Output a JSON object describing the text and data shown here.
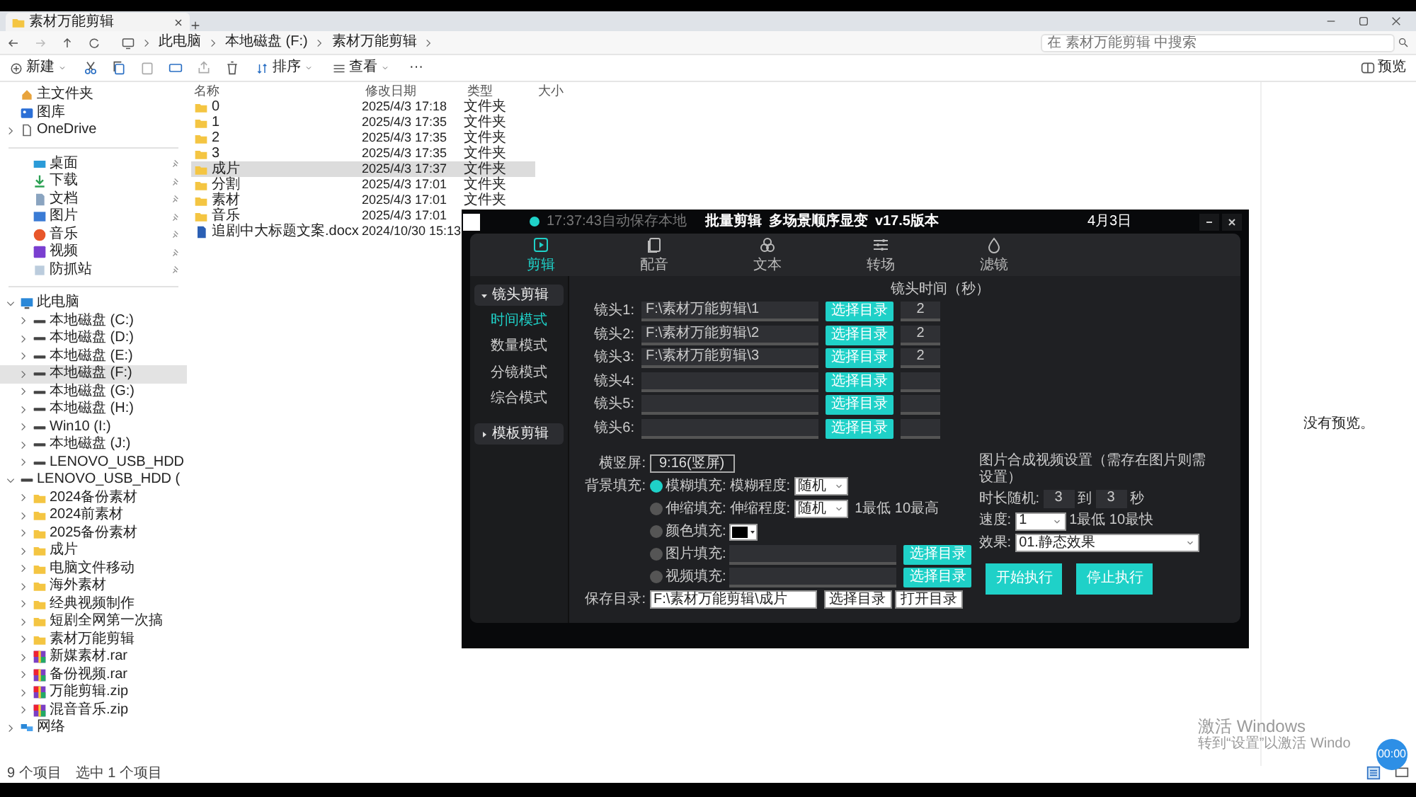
{
  "explorer": {
    "tab_title": "素材万能剪辑",
    "breadcrumb": [
      "此电脑",
      "本地磁盘 (F:)",
      "素材万能剪辑"
    ],
    "search": {
      "placeholder": "在 素材万能剪辑 中搜索"
    },
    "toolbar": {
      "new": "新建",
      "sort": "排序",
      "view": "查看",
      "more": "···",
      "preview": "预览"
    },
    "quick_access": [
      {
        "kind": "home",
        "label": "主文件夹",
        "selected": false
      },
      {
        "kind": "gallery",
        "label": "图库",
        "selected": false
      },
      {
        "kind": "cloud",
        "label": "OneDrive",
        "selected": false,
        "expanded": false
      }
    ],
    "pinned": [
      {
        "kind": "desktop",
        "label": "桌面",
        "selected": false
      },
      {
        "kind": "download",
        "label": "下载",
        "selected": false
      },
      {
        "kind": "document",
        "label": "文档",
        "selected": false
      },
      {
        "kind": "picture",
        "label": "图片",
        "selected": false
      },
      {
        "kind": "music",
        "label": "音乐",
        "selected": false
      },
      {
        "kind": "video",
        "label": "视频",
        "selected": false
      },
      {
        "kind": "app",
        "label": "防抓站",
        "selected": false
      }
    ],
    "tree": [
      {
        "kind": "pc",
        "label": "此电脑",
        "selected": false,
        "expanded": true,
        "children": [
          {
            "kind": "drive",
            "label": "本地磁盘 (C:)",
            "selected": false,
            "expanded": false
          },
          {
            "kind": "drive",
            "label": "本地磁盘 (D:)",
            "selected": false,
            "expanded": false
          },
          {
            "kind": "drive",
            "label": "本地磁盘 (E:)",
            "selected": false,
            "expanded": false
          },
          {
            "kind": "drive",
            "label": "本地磁盘 (F:)",
            "selected": true,
            "expanded": false
          },
          {
            "kind": "drive",
            "label": "本地磁盘 (G:)",
            "selected": false,
            "expanded": false
          },
          {
            "kind": "drive",
            "label": "本地磁盘 (H:)",
            "selected": false,
            "expanded": false
          },
          {
            "kind": "drive",
            "label": "Win10 (I:)",
            "selected": false,
            "expanded": false
          },
          {
            "kind": "drive",
            "label": "本地磁盘 (J:)",
            "selected": false,
            "expanded": false
          },
          {
            "kind": "drive",
            "label": "LENOVO_USB_HDD",
            "selected": false,
            "expanded": false
          }
        ]
      },
      {
        "kind": "drive",
        "label": "LENOVO_USB_HDD (",
        "selected": false,
        "expanded": true,
        "children": [
          {
            "kind": "folder",
            "label": "2024备份素材",
            "selected": false,
            "expanded": false
          },
          {
            "kind": "folder",
            "label": "2024前素材",
            "selected": false,
            "expanded": false
          },
          {
            "kind": "folder",
            "label": "2025备份素材",
            "selected": false,
            "expanded": false
          },
          {
            "kind": "folder",
            "label": "成片",
            "selected": false,
            "expanded": false
          },
          {
            "kind": "folder",
            "label": "电脑文件移动",
            "selected": false,
            "expanded": false
          },
          {
            "kind": "folder",
            "label": "海外素材",
            "selected": false,
            "expanded": false
          },
          {
            "kind": "folder",
            "label": "经典视频制作",
            "selected": false,
            "expanded": false
          },
          {
            "kind": "folder",
            "label": "短剧全网第一次搞",
            "selected": false,
            "expanded": false
          },
          {
            "kind": "folder",
            "label": "素材万能剪辑",
            "selected": false,
            "expanded": false
          },
          {
            "kind": "archive",
            "label": "新媒素材.rar",
            "selected": false,
            "expanded": false
          },
          {
            "kind": "archive",
            "label": "备份视频.rar",
            "selected": false,
            "expanded": false
          },
          {
            "kind": "archive",
            "label": "万能剪辑.zip",
            "selected": false,
            "expanded": false
          },
          {
            "kind": "archive",
            "label": "混音音乐.zip",
            "selected": false,
            "expanded": false
          }
        ]
      },
      {
        "kind": "network",
        "label": "网络",
        "selected": false,
        "expanded": false
      }
    ],
    "columns": [
      "名称",
      "修改日期",
      "类型",
      "大小"
    ],
    "files": [
      {
        "kind": "folder",
        "name": "0",
        "date": "2025/4/3 17:18",
        "type": "文件夹",
        "selected": false
      },
      {
        "kind": "folder",
        "name": "1",
        "date": "2025/4/3 17:35",
        "type": "文件夹",
        "selected": false
      },
      {
        "kind": "folder",
        "name": "2",
        "date": "2025/4/3 17:35",
        "type": "文件夹",
        "selected": false
      },
      {
        "kind": "folder",
        "name": "3",
        "date": "2025/4/3 17:35",
        "type": "文件夹",
        "selected": false
      },
      {
        "kind": "folder",
        "name": "成片",
        "date": "2025/4/3 17:37",
        "type": "文件夹",
        "selected": true
      },
      {
        "kind": "folder",
        "name": "分割",
        "date": "2025/4/3 17:01",
        "type": "文件夹",
        "selected": false
      },
      {
        "kind": "folder",
        "name": "素材",
        "date": "2025/4/3 17:01",
        "type": "文件夹",
        "selected": false
      },
      {
        "kind": "folder",
        "name": "音乐",
        "date": "2025/4/3 17:01",
        "selected": false
      },
      {
        "kind": "docx",
        "name": "追剧中大标题文案.docx",
        "date": "2024/10/30 15:13",
        "selected": false
      }
    ],
    "preview_empty": "没有预览。",
    "status": [
      "9 个项目",
      "选中 1 个项目"
    ]
  },
  "app": {
    "autosave": "17:37:43自动保存本地",
    "title_items": [
      "批量剪辑",
      "多场景顺序显变",
      "v17.5版本"
    ],
    "date": "4月3日",
    "tabs": [
      {
        "kind": "video",
        "label": "剪辑",
        "selected": true
      },
      {
        "kind": "pages",
        "label": "配音",
        "selected": false
      },
      {
        "kind": "circles",
        "label": "文本",
        "selected": false
      },
      {
        "kind": "sliders",
        "label": "转场",
        "selected": false
      },
      {
        "kind": "drop",
        "label": "滤镜",
        "selected": false
      }
    ],
    "nav": [
      {
        "label": "镜头剪辑",
        "expanded": true,
        "items": [
          {
            "label": "时间模式",
            "selected": true
          },
          {
            "label": "数量模式",
            "selected": false
          },
          {
            "label": "分镜模式",
            "selected": false
          },
          {
            "label": "综合模式",
            "selected": false
          }
        ]
      },
      {
        "label": "模板剪辑",
        "expanded": false
      }
    ],
    "clip_time_header": "镜头时间（秒）",
    "clips": [
      {
        "label": "镜头1:",
        "path": "F:\\素材万能剪辑\\1",
        "button": "选择目录",
        "seconds": "2"
      },
      {
        "label": "镜头2:",
        "path": "F:\\素材万能剪辑\\2",
        "button": "选择目录",
        "seconds": "2"
      },
      {
        "label": "镜头3:",
        "path": "F:\\素材万能剪辑\\3",
        "button": "选择目录",
        "seconds": "2"
      },
      {
        "label": "镜头4:",
        "button": "选择目录"
      },
      {
        "label": "镜头5:",
        "button": "选择目录"
      },
      {
        "label": "镜头6:",
        "button": "选择目录"
      }
    ],
    "orientation": {
      "label": "横竖屏:",
      "value": "9:16(竖屏)"
    },
    "background_label": "背景填充:",
    "background": [
      {
        "kind": "select",
        "label": "模糊填充:",
        "selected": true,
        "sublabel": "模糊程度:",
        "value": "随机"
      },
      {
        "kind": "select",
        "label": "伸缩填充:",
        "selected": false,
        "sublabel": "伸缩程度:",
        "value": "随机",
        "hint": "1最低 10最高"
      },
      {
        "kind": "color",
        "label": "颜色填充:",
        "selected": false
      },
      {
        "kind": "folder",
        "label": "图片填充:",
        "selected": false,
        "button": "选择目录"
      },
      {
        "kind": "folder",
        "label": "视频填充:",
        "selected": false,
        "button": "选择目录"
      }
    ],
    "save": {
      "label": "保存目录:",
      "value": "F:\\素材万能剪辑\\成片",
      "buttons": [
        "选择目录",
        "打开目录"
      ]
    },
    "image_video": {
      "title": "图片合成视频设置（需存在图片则需设置）",
      "duration_label": "时长随机:",
      "from": "3",
      "to_label": "到",
      "to": "3",
      "unit": "秒",
      "speed_label": "速度:",
      "speed": "1",
      "speed_hint": "1最低 10最快",
      "effect_label": "效果:",
      "effect": "01.静态效果"
    },
    "actions": [
      "开始执行",
      "停止执行"
    ]
  },
  "activation": [
    "激活 Windows",
    "转到“设置”以激活 Windo"
  ],
  "recorder": "00:00"
}
